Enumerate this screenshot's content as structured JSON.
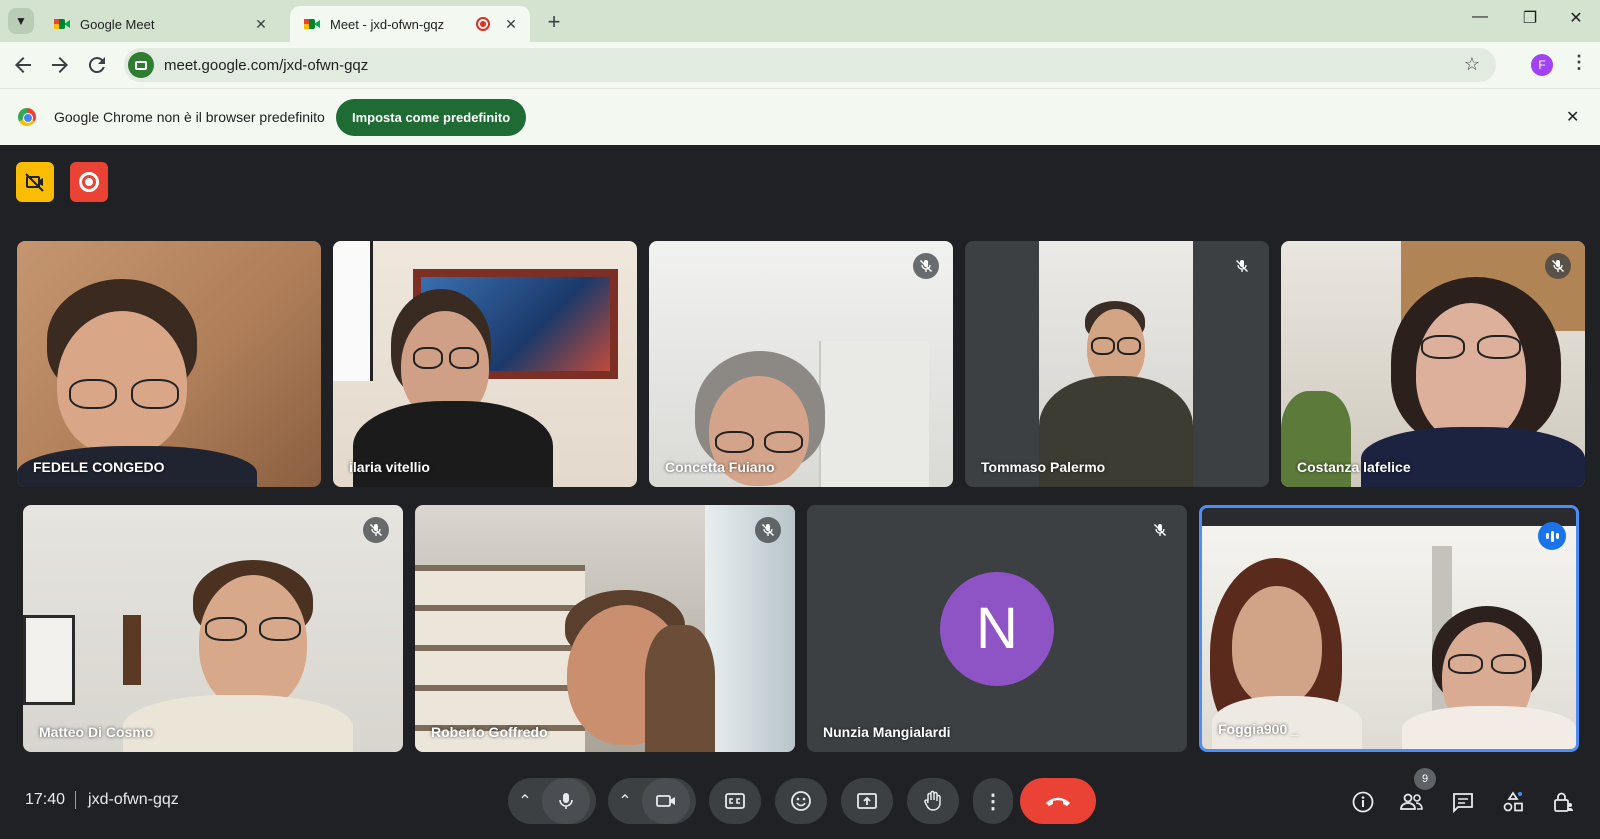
{
  "browser": {
    "tabs": [
      {
        "title": "Google Meet",
        "close": "✕"
      },
      {
        "title": "Meet - jxd-ofwn-gqz",
        "close": "✕"
      }
    ],
    "new_tab": "+",
    "window_controls": {
      "minimize": "—",
      "restore": "❐",
      "close": "✕"
    },
    "url": "meet.google.com/jxd-ofwn-gqz",
    "profile_initial": "F"
  },
  "infobar": {
    "message": "Google Chrome non è il browser predefinito",
    "button_label": "Imposta come predefinito",
    "close": "✕"
  },
  "meeting": {
    "time": "17:40",
    "code": "jxd-ofwn-gqz",
    "participant_count": "9",
    "participants": [
      {
        "name": "FEDELE CONGEDO",
        "muted": false
      },
      {
        "name": "ilaria vitellio",
        "muted": false
      },
      {
        "name": "Concetta Fuiano",
        "muted": true
      },
      {
        "name": "Tommaso Palermo",
        "muted": true
      },
      {
        "name": "Costanza lafelice",
        "muted": true
      },
      {
        "name": "Matteo Di Cosmo",
        "muted": true
      },
      {
        "name": "Roberto Goffredo",
        "muted": true
      },
      {
        "name": "Nunzia Mangialardi",
        "muted": true,
        "avatar_initial": "N",
        "avatar_color": "#8e54c6"
      },
      {
        "name": "Foggia900 _",
        "muted": false,
        "speaking": true
      }
    ]
  },
  "colors": {
    "accent": "#1a73e8",
    "end_call": "#ea4335",
    "record": "#ea4335",
    "video_badge": "#fbbc04",
    "infobar_button": "#1e6b33"
  }
}
